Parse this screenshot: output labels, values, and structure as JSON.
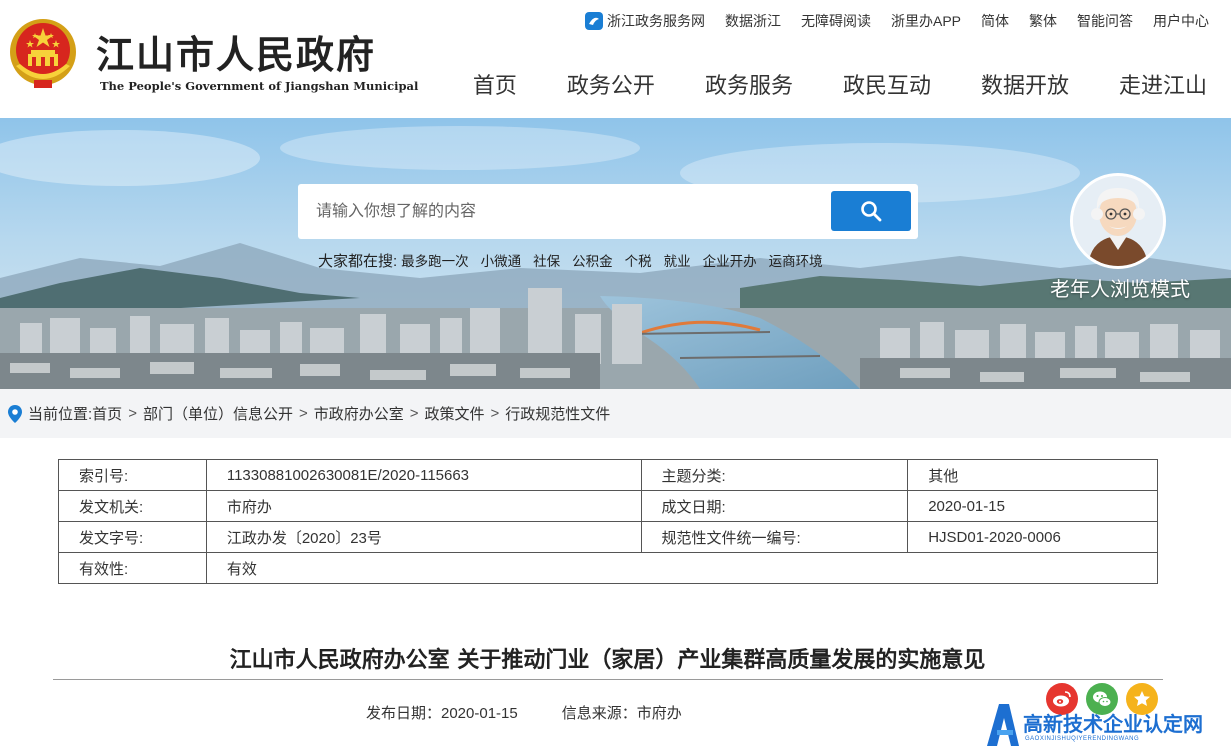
{
  "header": {
    "site_title": "江山市人民政府",
    "site_subtitle": "The People's Government of Jiangshan Municipal",
    "top_links": [
      "浙江政务服务网",
      "数据浙江",
      "无障碍阅读",
      "浙里办APP",
      "简体",
      "繁体",
      "智能问答",
      "用户中心"
    ],
    "nav": [
      "首页",
      "政务公开",
      "政务服务",
      "政民互动",
      "数据开放",
      "走进江山"
    ]
  },
  "search": {
    "placeholder": "请输入你想了解的内容",
    "hot_label": "大家都在搜:",
    "hot_items": [
      "最多跑一次",
      "小微通",
      "社保",
      "公积金",
      "个税",
      "就业",
      "企业开办",
      "运商环境"
    ]
  },
  "elder_mode": {
    "label": "老年人浏览模式"
  },
  "breadcrumb": {
    "label": "当前位置:",
    "items": [
      "首页",
      "部门（单位）信息公开",
      "市政府办公室",
      "政策文件",
      "行政规范性文件"
    ]
  },
  "info": {
    "rows": [
      [
        "索引号:",
        "11330881002630081E/2020-115663",
        "主题分类:",
        "其他"
      ],
      [
        "发文机关:",
        "市府办",
        "成文日期:",
        "2020-01-15"
      ],
      [
        "发文字号:",
        "江政办发〔2020〕23号",
        "规范性文件统一编号:",
        "HJSD01-2020-0006"
      ],
      [
        "有效性:",
        "有效"
      ]
    ]
  },
  "article": {
    "title": "江山市人民政府办公室 关于推动门业（家居）产业集群高质量发展的实施意见",
    "publish_date": "发布日期：2020-01-15",
    "source": "信息来源：市府办"
  },
  "watermark": {
    "text": "高新技术企业认定网",
    "sub": "GAOXINJISHUQIYERENDINGWANG"
  },
  "colors": {
    "accent": "#1a7ed4",
    "weibo": "#e6362f",
    "wechat": "#4cb050",
    "favorite": "#f5b31c"
  }
}
